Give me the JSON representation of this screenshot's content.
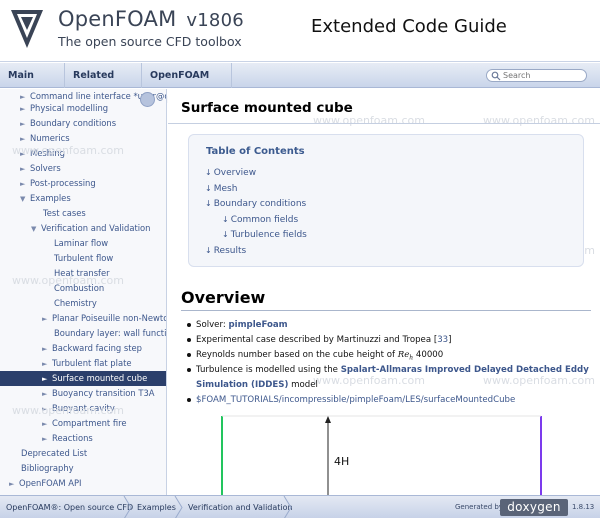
{
  "header": {
    "brand": "OpenFOAM",
    "version": "v1806",
    "tagline": "The open source CFD toolbox",
    "guide_title": "Extended Code Guide"
  },
  "navbar": {
    "items": [
      "Main Page",
      "Related Pages",
      "OpenFOAM API"
    ],
    "search_placeholder": "Search"
  },
  "sidebar": {
    "items": [
      "Command line interface *user@ope",
      "Physical modelling",
      "Boundary conditions",
      "Numerics",
      "Meshing",
      "Solvers",
      "Post-processing",
      "Examples",
      "Test cases",
      "Verification and Validation",
      "Laminar flow",
      "Turbulent flow",
      "Heat transfer",
      "Combustion",
      "Chemistry",
      "Planar Poiseuille non-Newtoni",
      "Boundary layer: wall functions",
      "Backward facing step",
      "Turbulent flat plate",
      "Surface mounted cube",
      "Buoyancy transition T3A",
      "Buoyant cavity",
      "Compartment fire",
      "Reactions",
      "Deprecated List",
      "Bibliography",
      "OpenFOAM API"
    ]
  },
  "main": {
    "watermark": "www.openfoam.com",
    "page_title": "Surface mounted cube",
    "toc": {
      "title": "Table of Contents",
      "items": [
        "Overview",
        "Mesh",
        "Boundary conditions",
        "Common fields",
        "Turbulence fields",
        "Results"
      ]
    },
    "overview_heading": "Overview",
    "bullets": {
      "solver_prefix": "Solver: ",
      "solver_link": "pimpleFoam",
      "exp_text": "Experimental case described by Martinuzzi and Tropea [",
      "exp_ref": "33",
      "exp_close": "]",
      "re_text": "Reynolds number based on the cube height of ",
      "re_symbol": "Re",
      "re_sub": "h",
      "re_value": " 40000",
      "turb_text": "Turbulence is modelled using the ",
      "turb_link1": "Spalart-Allmaras Improved Delayed Detached Eddy",
      "turb_link2": "Simulation (IDDES)",
      "turb_suffix": " model",
      "path_link": "$FOAM_TUTORIALS/incompressible/pimpleFoam/LES/surfaceMountedCube"
    },
    "figure_label": "4H"
  },
  "footer": {
    "crumbs": [
      "OpenFOAM®: Open source CFD",
      "Examples",
      "Verification and Validation"
    ],
    "generated_by": "Generated by",
    "doxygen": "doxygen",
    "doxygen_version": "1.8.13"
  }
}
